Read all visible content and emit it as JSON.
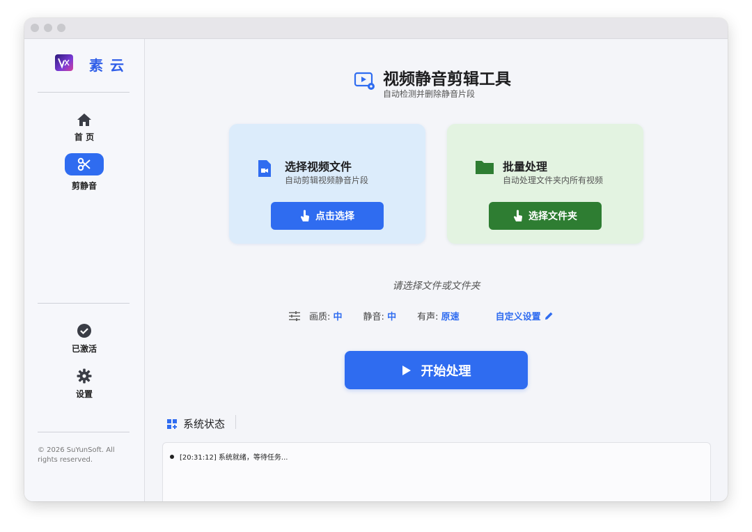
{
  "app": {
    "brand": "素云",
    "title": "视频静音剪辑工具",
    "subtitle": "自动检测并删除静音片段"
  },
  "sidebar": {
    "items": [
      {
        "label": "首 页",
        "icon": "home-icon"
      },
      {
        "label": "剪静音",
        "icon": "scissors-icon",
        "active": true
      }
    ],
    "bottom_items": [
      {
        "label": "已激活",
        "icon": "check-circle-icon"
      },
      {
        "label": "设置",
        "icon": "gear-icon"
      }
    ],
    "copyright": "© 2026 SuYunSoft. All rights reserved."
  },
  "cards": {
    "single": {
      "title": "选择视频文件",
      "subtitle": "自动剪辑视频静音片段",
      "button": "点击选择"
    },
    "batch": {
      "title": "批量处理",
      "subtitle": "自动处理文件夹内所有视频",
      "button": "选择文件夹"
    }
  },
  "hint": "请选择文件或文件夹",
  "settings": {
    "quality_label": "画质:",
    "quality_value": "中",
    "silence_label": "静音:",
    "silence_value": "中",
    "sound_label": "有声:",
    "sound_value": "原速",
    "custom_label": "自定义设置"
  },
  "start_button": "开始处理",
  "status": {
    "title": "系统状态",
    "log": [
      "[20:31:12] 系统就绪，等待任务..."
    ]
  },
  "colors": {
    "accent": "#2f6cf0",
    "green": "#2e7d32",
    "blue_card": "#dcecfb",
    "green_card": "#e3f3e1"
  }
}
